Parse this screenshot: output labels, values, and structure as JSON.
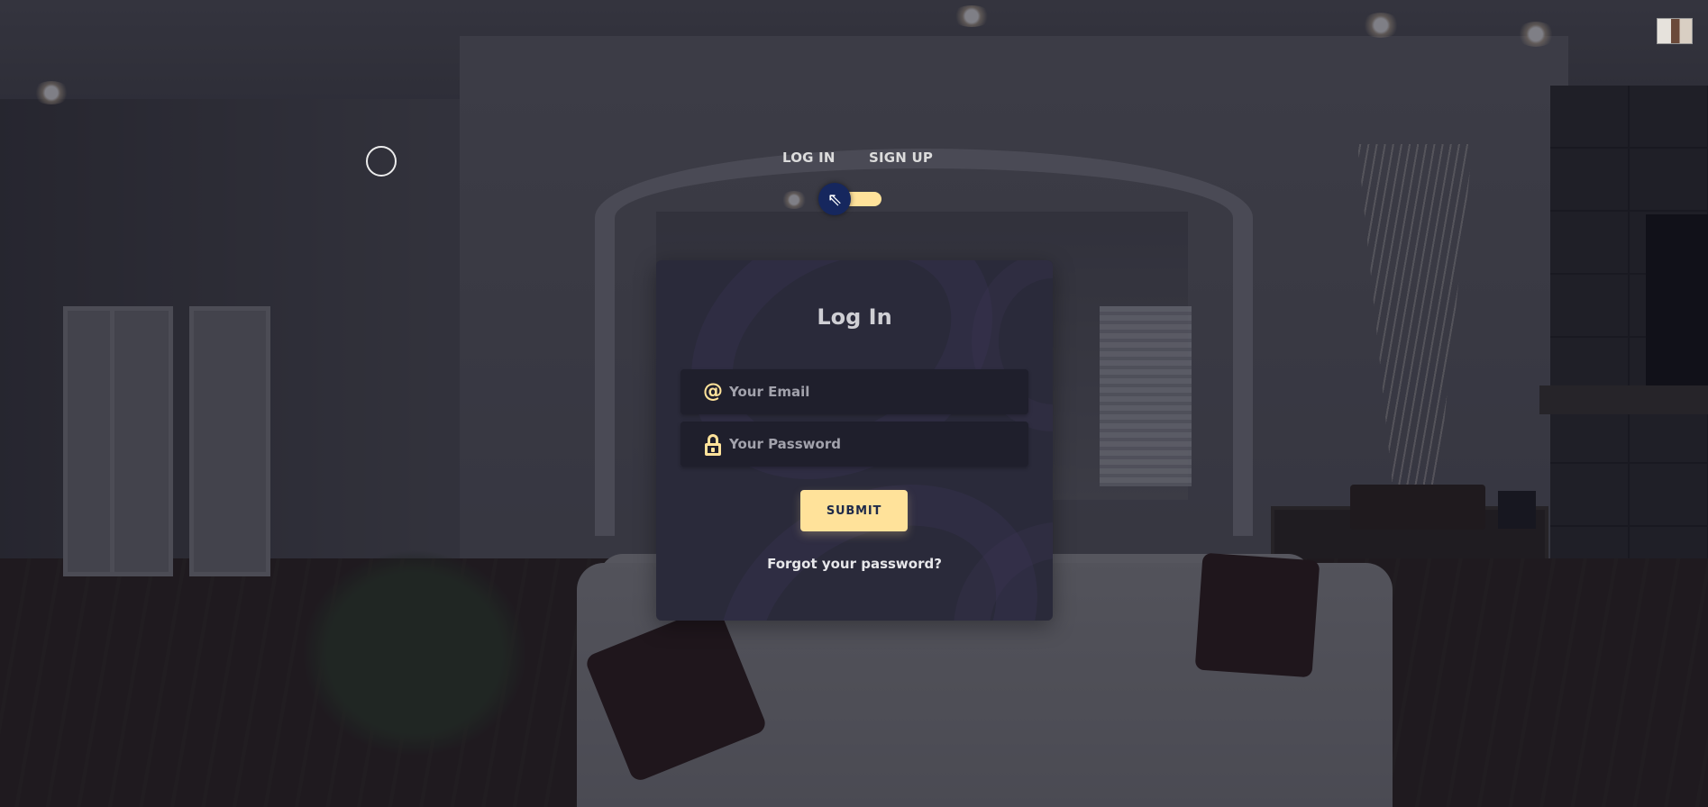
{
  "tabs": {
    "login_label": "LOG IN",
    "signup_label": "SIGN UP"
  },
  "toggle": {
    "icon": "arrow-up-left-icon",
    "glyph": "⇖",
    "track_color": "#ffe29a",
    "knob_color": "#16275e"
  },
  "card": {
    "title": "Log In",
    "email": {
      "placeholder": "Your Email",
      "value": "",
      "icon": "at-icon",
      "glyph": "@"
    },
    "password": {
      "placeholder": "Your Password",
      "value": "",
      "icon": "lock-icon"
    },
    "submit_label": "SUBMIT",
    "forgot_label": "Forgot your password?"
  },
  "colors": {
    "accent": "#ffe29a",
    "card_background": "#2a2a3a",
    "field_background": "#1f1f2c"
  }
}
